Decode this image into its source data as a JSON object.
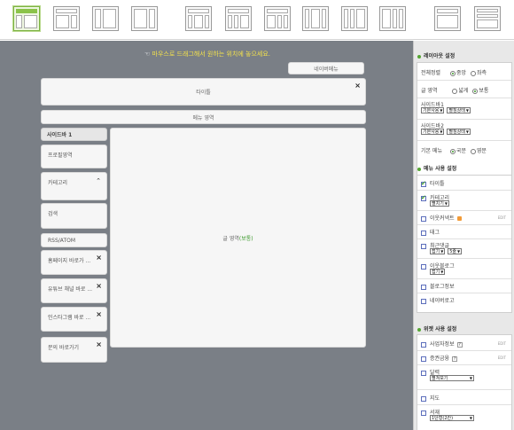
{
  "toolbar": {
    "layouts": [
      {
        "name": "layout-1",
        "selected": true
      },
      {
        "name": "layout-2",
        "selected": false
      },
      {
        "name": "layout-3",
        "selected": false
      },
      {
        "name": "layout-4",
        "selected": false
      },
      {
        "name": "layout-5",
        "selected": false
      },
      {
        "name": "layout-6",
        "selected": false
      },
      {
        "name": "layout-7",
        "selected": false
      },
      {
        "name": "layout-8",
        "selected": false
      },
      {
        "name": "layout-9",
        "selected": false
      },
      {
        "name": "layout-10",
        "selected": false
      },
      {
        "name": "layout-11",
        "selected": false
      },
      {
        "name": "layout-12",
        "selected": false
      }
    ],
    "accent": "#8bc34a"
  },
  "canvas": {
    "hint": "마우스로 드래그해서 원하는 위치에 놓으세요.",
    "nav_menu": "네이버메뉴",
    "title_box": "타이틀",
    "menu_box": "메뉴 영역",
    "sidebar_header": "사이드바 1",
    "main_area_prefix": "글 영역",
    "main_area_suffix": "(보통)",
    "sidebar_items": [
      {
        "label": "프로필영역",
        "icon": "none"
      },
      {
        "label": "카테고리",
        "icon": "chevron-up"
      },
      {
        "label": "검색",
        "icon": "none"
      },
      {
        "label": "RSS/ATOM",
        "icon": "none"
      },
      {
        "label": "홈페이지 바로가 ...",
        "icon": "close"
      },
      {
        "label": "유튜브 채널 바로 ...",
        "icon": "close"
      },
      {
        "label": "인스타그램 바로 ...",
        "icon": "close"
      },
      {
        "label": "문의 바로가기",
        "icon": "close"
      }
    ],
    "bg": "#7a7f86"
  },
  "layout_settings": {
    "title": "레이아웃 설정",
    "rows": {
      "alignment": {
        "label": "전체정렬",
        "opt1": "중앙",
        "opt2": "좌측",
        "selected": 1
      },
      "content_width": {
        "label": "글 영역",
        "opt1": "넓게",
        "opt2": "보통",
        "selected": 2
      },
      "sidebar1": {
        "label": "사이드바1",
        "select1": "기본사용",
        "select2": "펼침상태"
      },
      "sidebar2": {
        "label": "사이드바2",
        "select1": "기본사용",
        "select2": "펼침상태"
      },
      "default_menu": {
        "label": "기본 메뉴",
        "opt1": "국문",
        "opt2": "영문",
        "selected": 1
      }
    }
  },
  "menu_settings": {
    "title": "메뉴 사용 설정",
    "items": {
      "title": {
        "label": "타이틀",
        "checked": true
      },
      "category": {
        "label": "카테고리",
        "checked": true,
        "select": "펼치기"
      },
      "episode": {
        "label": "이웃커넥트",
        "checked": false,
        "edit": "EDIT"
      },
      "tag": {
        "label": "태그",
        "checked": false
      },
      "recent_comments": {
        "label": "최근댓글",
        "checked": false,
        "select1": "접기",
        "select2": "5줄"
      },
      "neighbor_blogs": {
        "label": "이웃블로그",
        "checked": false,
        "select": "접기"
      },
      "blog_info": {
        "label": "블로그정보",
        "checked": false
      },
      "naver_link": {
        "label": "네이버로고",
        "checked": false
      }
    }
  },
  "widget_settings": {
    "title": "위젯 사용 설정",
    "items": {
      "business": {
        "label": "사업자정보",
        "checked": false,
        "edit": "EDIT"
      },
      "securities": {
        "label": "증권금융",
        "checked": false,
        "edit": "EDIT"
      },
      "calendar": {
        "label": "달력",
        "checked": false,
        "select": "펼쳐보기"
      },
      "map": {
        "label": "지도",
        "checked": false
      },
      "books": {
        "label": "서재",
        "checked": false,
        "select": "1단형(2칸)"
      }
    }
  }
}
